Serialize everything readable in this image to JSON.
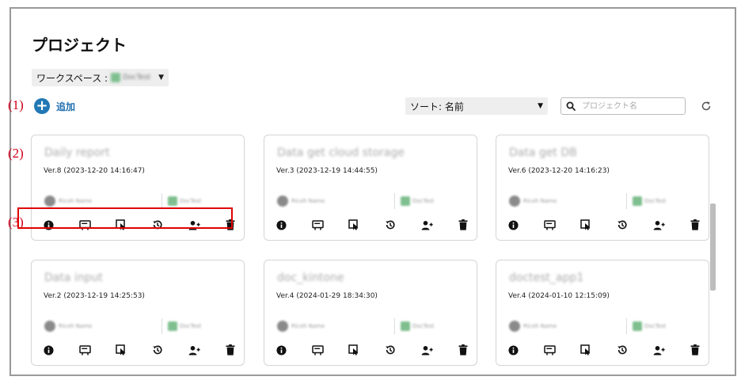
{
  "page": {
    "title": "プロジェクト"
  },
  "workspace": {
    "label": "ワークスペース :",
    "name": "DocTest"
  },
  "annotations": [
    "(1)",
    "(2)",
    "(3)"
  ],
  "toolbar": {
    "add_label": "追加",
    "sort_label": "ソート: 名前",
    "search_placeholder": "プロジェクト名",
    "icons": [
      "plus-icon",
      "search-icon",
      "refresh-icon"
    ]
  },
  "card_actions": [
    "info-icon",
    "preview-icon",
    "run-icon",
    "history-icon",
    "share-user-icon",
    "delete-icon"
  ],
  "cards": [
    {
      "title": "Daily report",
      "version": "Ver.8 (2023-12-20 14:16:47)",
      "owner": "Ricoh Name",
      "workspace": "DocTest"
    },
    {
      "title": "Data get cloud storage",
      "version": "Ver.3 (2023-12-19 14:44:55)",
      "owner": "Ricoh Name",
      "workspace": "DocTest"
    },
    {
      "title": "Data get DB",
      "version": "Ver.6 (2023-12-20 14:16:23)",
      "owner": "Ricoh Name",
      "workspace": "DocTest"
    },
    {
      "title": "Data input",
      "version": "Ver.2 (2023-12-19 14:25:53)",
      "owner": "Ricoh Name",
      "workspace": "DocTest"
    },
    {
      "title": "doc_kintone",
      "version": "Ver.4 (2024-01-29 18:34:30)",
      "owner": "Ricoh Name",
      "workspace": "DocTest"
    },
    {
      "title": "doctest_app1",
      "version": "Ver.4 (2024-01-10 12:15:09)",
      "owner": "Ricoh Name",
      "workspace": "DocTest"
    }
  ],
  "colors": {
    "accent": "#2178b5",
    "annotation": "#e00000"
  }
}
